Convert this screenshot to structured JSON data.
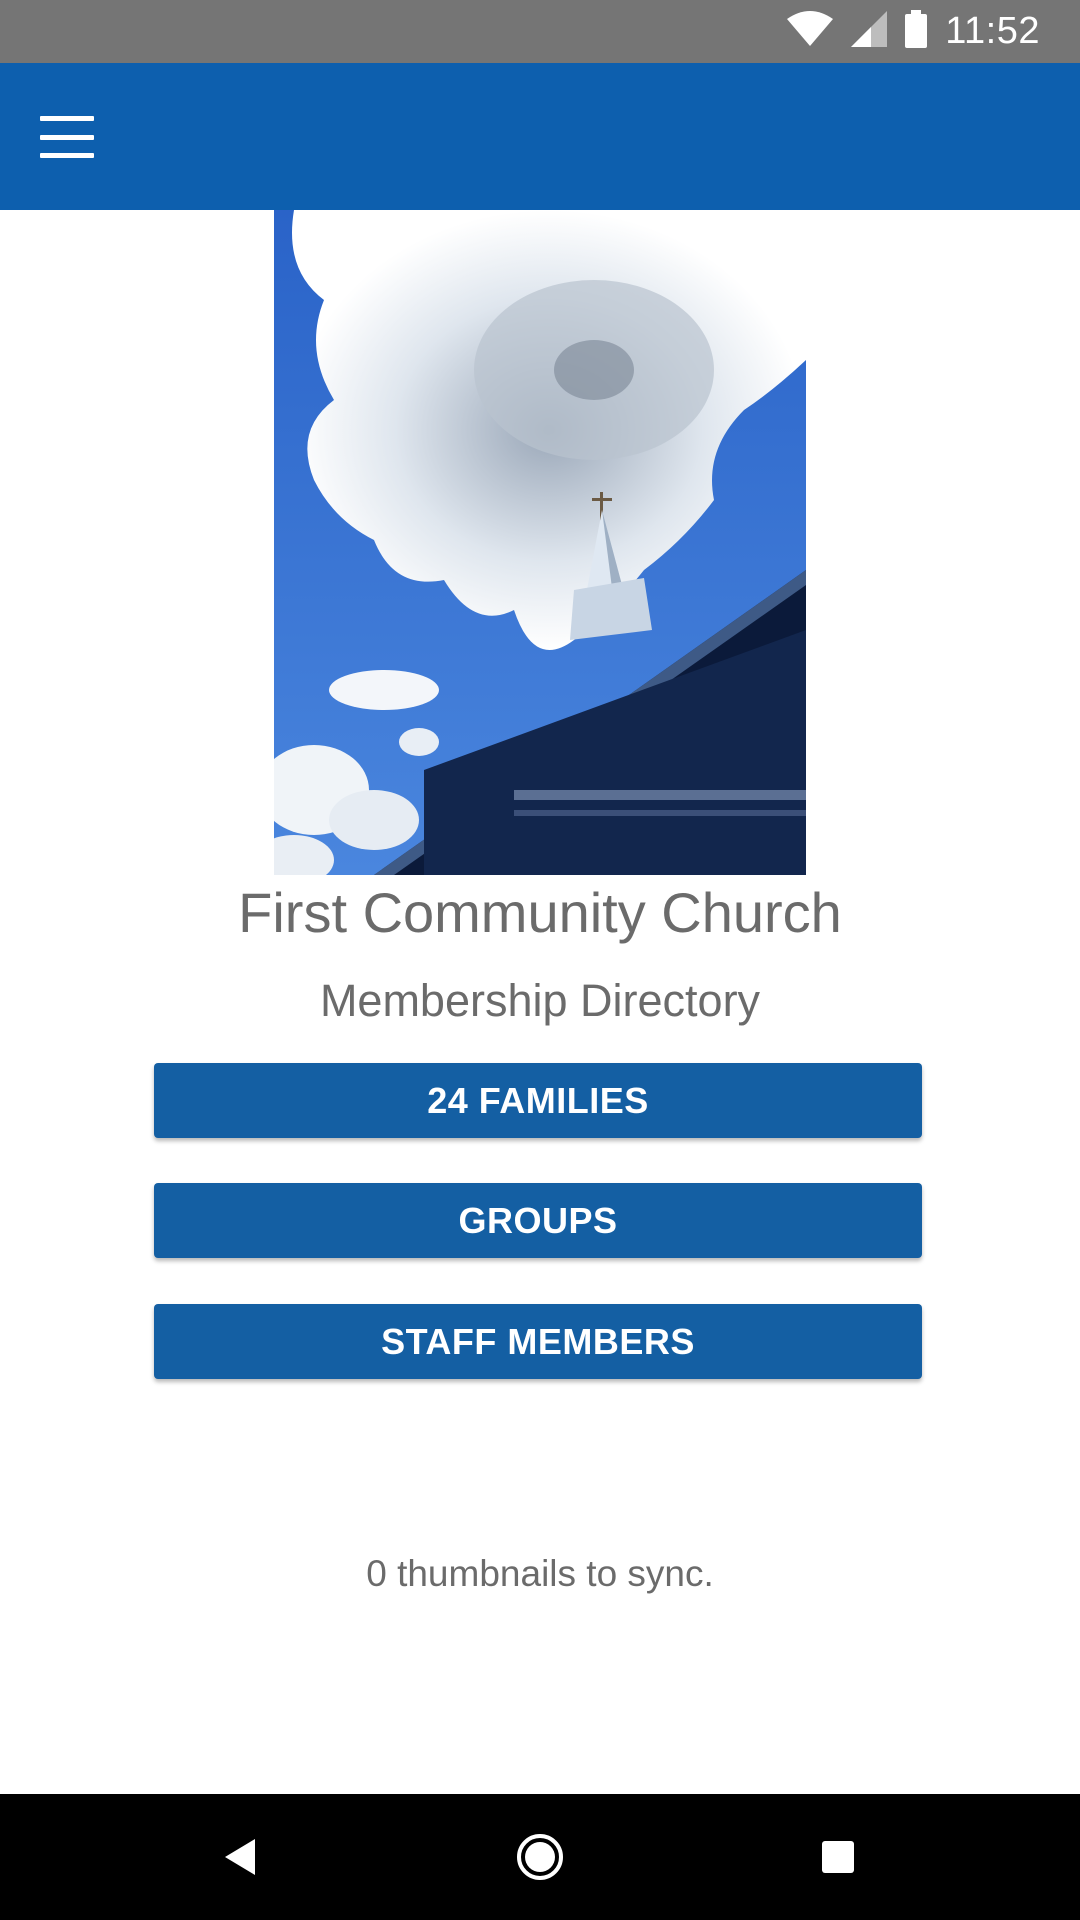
{
  "status_bar": {
    "time": "11:52",
    "icons": [
      "wifi-icon",
      "cellular-signal-icon",
      "battery-icon"
    ]
  },
  "app_bar": {
    "menu_icon": "hamburger-menu-icon",
    "color": "#0d5fae"
  },
  "hero_image": {
    "alt": "church steeple against cloudy blue sky"
  },
  "header": {
    "church_name": "First Community Church",
    "subtitle": "Membership Directory"
  },
  "buttons": {
    "families_label": "24 FAMILIES",
    "groups_label": "GROUPS",
    "staff_label": "STAFF MEMBERS",
    "color": "#145fa3"
  },
  "sync": {
    "status_text": "0 thumbnails to sync."
  },
  "nav_bar": {
    "back_icon": "back-triangle-icon",
    "home_icon": "home-circle-icon",
    "recents_icon": "recents-square-icon"
  }
}
